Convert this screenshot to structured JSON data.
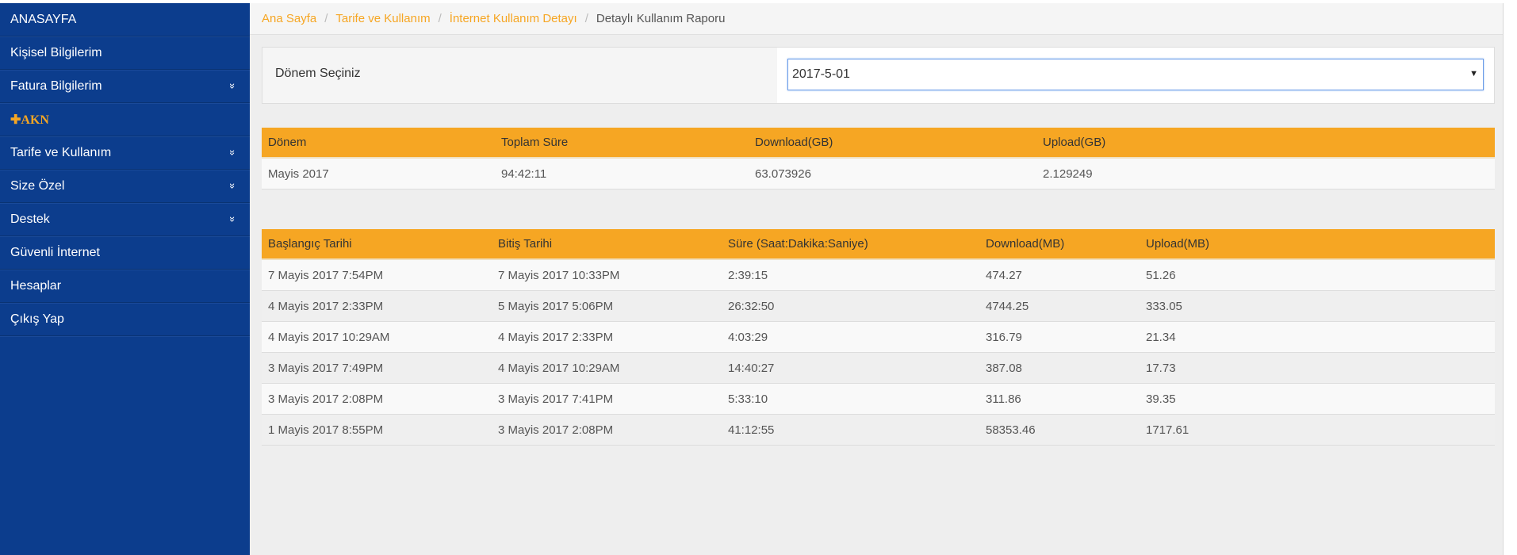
{
  "sidebar": {
    "items": [
      {
        "label": "ANASAYFA",
        "chevron": false
      },
      {
        "label": "Kişisel Bilgilerim",
        "chevron": false
      },
      {
        "label": "Fatura Bilgilerim",
        "chevron": true
      },
      {
        "label": "✚AKN",
        "chevron": false
      },
      {
        "label": "Tarife ve Kullanım",
        "chevron": true
      },
      {
        "label": "Size Özel",
        "chevron": true
      },
      {
        "label": "Destek",
        "chevron": true
      },
      {
        "label": "Güvenli İnternet",
        "chevron": false
      },
      {
        "label": "Hesaplar",
        "chevron": false
      },
      {
        "label": "Çıkış Yap",
        "chevron": false
      }
    ],
    "chevron_glyph": "»",
    "bg_color": "#0c3d8d",
    "accent_color": "#f6a623"
  },
  "breadcrumb": {
    "items": [
      "Ana Sayfa",
      "Tarife ve Kullanım",
      "İnternet Kullanım Detayı"
    ],
    "active": "Detaylı Kullanım Raporu",
    "separator": "/"
  },
  "period": {
    "label": "Dönem Seçiniz",
    "selected": "2017-5-01",
    "arrow": "▼"
  },
  "summary_table": {
    "headers": [
      "Dönem",
      "Toplam Süre",
      "Download(GB)",
      "Upload(GB)"
    ],
    "rows": [
      [
        "Mayis 2017",
        "94:42:11",
        "63.073926",
        "2.129249"
      ]
    ]
  },
  "detail_table": {
    "headers": [
      "Başlangıç Tarihi",
      "Bitiş Tarihi",
      "Süre (Saat:Dakika:Saniye)",
      "Download(MB)",
      "Upload(MB)"
    ],
    "rows": [
      [
        "7 Mayis 2017 7:54PM",
        "7 Mayis 2017 10:33PM",
        "2:39:15",
        "474.27",
        "51.26"
      ],
      [
        "4 Mayis 2017 2:33PM",
        "5 Mayis 2017 5:06PM",
        "26:32:50",
        "4744.25",
        "333.05"
      ],
      [
        "4 Mayis 2017 10:29AM",
        "4 Mayis 2017 2:33PM",
        "4:03:29",
        "316.79",
        "21.34"
      ],
      [
        "3 Mayis 2017 7:49PM",
        "4 Mayis 2017 10:29AM",
        "14:40:27",
        "387.08",
        "17.73"
      ],
      [
        "3 Mayis 2017 2:08PM",
        "3 Mayis 2017 7:41PM",
        "5:33:10",
        "311.86",
        "39.35"
      ],
      [
        "1 Mayis 2017 8:55PM",
        "3 Mayis 2017 2:08PM",
        "41:12:55",
        "58353.46",
        "1717.61"
      ]
    ]
  }
}
